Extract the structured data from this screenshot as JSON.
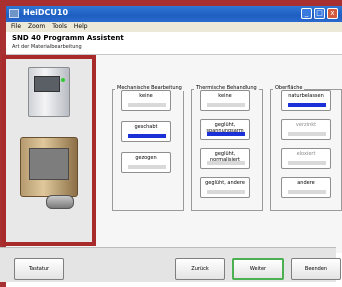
{
  "window": {
    "title": "HeiDCU10",
    "controls": {
      "minimize": "_",
      "maximize": "□",
      "close": "x"
    }
  },
  "menu": [
    "File",
    "Zoom",
    "Tools",
    "Help"
  ],
  "header": {
    "title": "SND 40 Programm Assistent",
    "subtitle": "Art der Materialbearbeitung"
  },
  "groups": [
    {
      "legend": "Mechanische Bearbeitung",
      "options": [
        {
          "label": "keine",
          "selected": false
        },
        {
          "label": "geschabt",
          "selected": true
        },
        {
          "label": "gezogen",
          "selected": false
        }
      ]
    },
    {
      "legend": "Thermische Behandlung",
      "options": [
        {
          "label": "keine",
          "selected": false
        },
        {
          "label": "geglüht, spannungsarm",
          "selected": true
        },
        {
          "label": "geglüht, normalisiert",
          "selected": false
        },
        {
          "label": "geglüht, andere",
          "selected": false
        }
      ]
    },
    {
      "legend": "Oberfläche",
      "options": [
        {
          "label": "naturbelassen",
          "selected": true
        },
        {
          "label": "verzinkt",
          "selected": false,
          "disabled": true
        },
        {
          "label": "eloxiert",
          "selected": false,
          "disabled": true
        },
        {
          "label": "andere",
          "selected": false
        }
      ]
    }
  ],
  "footer": {
    "keyboard": "Tastatur",
    "back": "Zurück",
    "next": "Weiter",
    "exit": "Beenden"
  },
  "colors": {
    "frame": "#a93030",
    "selected_bar": "#1c30d8",
    "titlebar": "#1e5ec0",
    "active_button_border": "#4caf50"
  }
}
